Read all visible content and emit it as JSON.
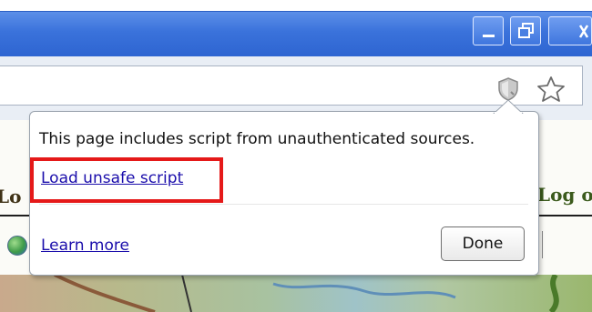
{
  "window": {
    "buttons": [
      "minimize",
      "restore",
      "close"
    ]
  },
  "toolbar": {
    "omnibox_value": "",
    "icons": [
      "shield-warning-icon",
      "bookmark-star-icon"
    ]
  },
  "page": {
    "left_text": "Lo",
    "right_text": "Log ou"
  },
  "bubble": {
    "message": "This page includes script from unauthenticated sources.",
    "load_link": "Load unsafe script",
    "learn_link": "Learn more",
    "done_label": "Done"
  },
  "colors": {
    "titlebar": "#3a72db",
    "link": "#1a0dab",
    "highlight": "#e51919"
  }
}
